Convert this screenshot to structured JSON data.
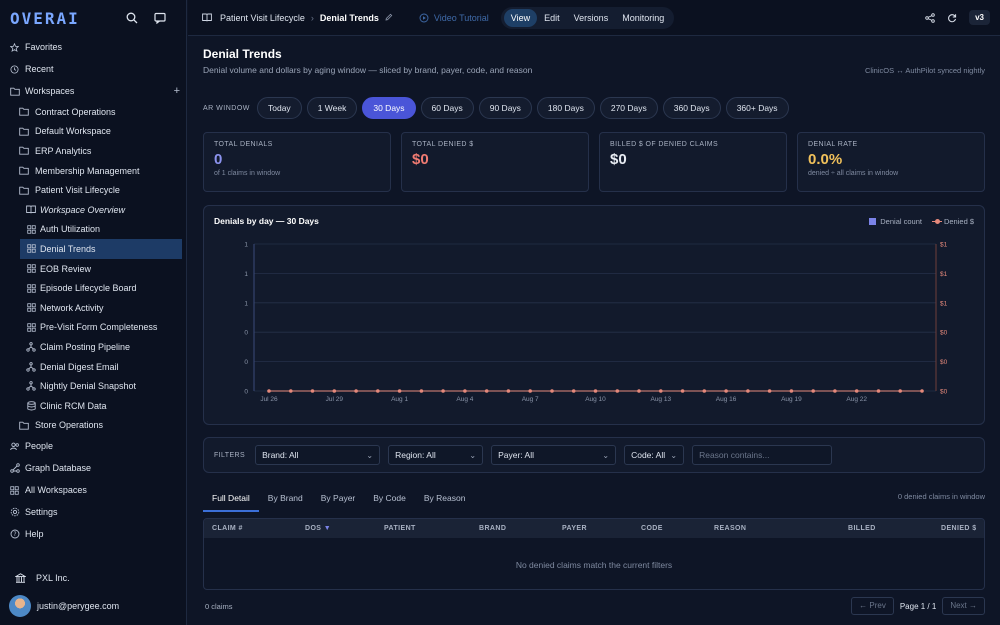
{
  "sidebar": {
    "logo": "OVERAI",
    "top_items": [
      {
        "label": "Favorites",
        "icon": "star-icon"
      },
      {
        "label": "Recent",
        "icon": "clock-icon"
      },
      {
        "label": "Workspaces",
        "icon": "folder-icon"
      }
    ],
    "workspaces": [
      {
        "label": "Contract Operations"
      },
      {
        "label": "Default Workspace"
      },
      {
        "label": "ERP Analytics"
      },
      {
        "label": "Membership Management"
      },
      {
        "label": "Patient Visit Lifecycle"
      }
    ],
    "children": [
      {
        "label": "Workspace Overview",
        "icon": "book-icon",
        "italic": true
      },
      {
        "label": "Auth Utilization",
        "icon": "grid-icon"
      },
      {
        "label": "Denial Trends",
        "icon": "grid-icon",
        "active": true
      },
      {
        "label": "EOB Review",
        "icon": "grid-icon"
      },
      {
        "label": "Episode Lifecycle Board",
        "icon": "grid-icon"
      },
      {
        "label": "Network Activity",
        "icon": "grid-icon"
      },
      {
        "label": "Pre-Visit Form Completeness",
        "icon": "grid-icon"
      },
      {
        "label": "Claim Posting Pipeline",
        "icon": "workflow-icon"
      },
      {
        "label": "Denial Digest Email",
        "icon": "workflow-icon"
      },
      {
        "label": "Nightly Denial Snapshot",
        "icon": "workflow-icon"
      },
      {
        "label": "Clinic RCM Data",
        "icon": "database-icon"
      }
    ],
    "store": {
      "label": "Store Operations"
    },
    "bottom_items": [
      {
        "label": "People",
        "icon": "people-icon"
      },
      {
        "label": "Graph Database",
        "icon": "graph-icon"
      },
      {
        "label": "All Workspaces",
        "icon": "grid-icon"
      },
      {
        "label": "Settings",
        "icon": "gear-icon"
      },
      {
        "label": "Help",
        "icon": "help-icon"
      }
    ],
    "org": "PXL Inc.",
    "user_email": "justin@perygee.com"
  },
  "topbar": {
    "parent": "Patient Visit Lifecycle",
    "current": "Denial Trends",
    "video": "Video Tutorial",
    "modes": [
      "View",
      "Edit",
      "Versions",
      "Monitoring"
    ],
    "active_mode": "View",
    "version": "v3"
  },
  "page": {
    "title": "Denial Trends",
    "subtitle": "Denial volume and dollars by aging window — sliced by brand, payer, code, and reason",
    "sync": "ClinicOS ↔ AuthPilot synced nightly"
  },
  "ar_window": {
    "label": "AR WINDOW",
    "options": [
      "Today",
      "1 Week",
      "30 Days",
      "60 Days",
      "90 Days",
      "180 Days",
      "270 Days",
      "360 Days",
      "360+ Days"
    ],
    "active": "30 Days"
  },
  "kpis": [
    {
      "label": "TOTAL DENIALS",
      "value": "0",
      "note": "of 1 claims in window",
      "color": "#8c93ee"
    },
    {
      "label": "TOTAL DENIED $",
      "value": "$0",
      "note": "",
      "color": "#f07b72"
    },
    {
      "label": "BILLED $ OF DENIED CLAIMS",
      "value": "$0",
      "note": "",
      "color": "#e8ecf3"
    },
    {
      "label": "DENIAL RATE",
      "value": "0.0%",
      "note": "denied ÷ all claims in window",
      "color": "#f1c15b"
    }
  ],
  "chart_data": {
    "type": "line",
    "title": "Denials by day — 30 Days",
    "legend": [
      {
        "name": "Denial count",
        "color": "#7b83e8"
      },
      {
        "name": "Denied $",
        "color": "#e5897b"
      }
    ],
    "x_ticks": [
      "Jul 26",
      "Jul 29",
      "Aug 1",
      "Aug 4",
      "Aug 7",
      "Aug 10",
      "Aug 13",
      "Aug 16",
      "Aug 19",
      "Aug 22"
    ],
    "y_left_ticks": [
      "1",
      "1",
      "1",
      "0",
      "0",
      "0"
    ],
    "y_right_ticks": [
      "$1",
      "$1",
      "$1",
      "$0",
      "$0",
      "$0"
    ],
    "series": [
      {
        "name": "Denial count",
        "values": [
          0,
          0,
          0,
          0,
          0,
          0,
          0,
          0,
          0,
          0,
          0,
          0,
          0,
          0,
          0,
          0,
          0,
          0,
          0,
          0,
          0,
          0,
          0,
          0,
          0,
          0,
          0,
          0,
          0,
          0,
          0
        ]
      },
      {
        "name": "Denied $",
        "values": [
          0,
          0,
          0,
          0,
          0,
          0,
          0,
          0,
          0,
          0,
          0,
          0,
          0,
          0,
          0,
          0,
          0,
          0,
          0,
          0,
          0,
          0,
          0,
          0,
          0,
          0,
          0,
          0,
          0,
          0,
          0
        ]
      }
    ],
    "grid": true,
    "legend_position": "top-right"
  },
  "filters": {
    "label": "FILTERS",
    "brand": "Brand: All",
    "region": "Region: All",
    "payer": "Payer: All",
    "code": "Code: All",
    "reason_placeholder": "Reason contains..."
  },
  "tabs": [
    "Full Detail",
    "By Brand",
    "By Payer",
    "By Code",
    "By Reason"
  ],
  "active_tab": "Full Detail",
  "denied_count_text": "0 denied claims in window",
  "table": {
    "columns": [
      "CLAIM #",
      "DOS",
      "PATIENT",
      "BRAND",
      "PAYER",
      "CODE",
      "REASON",
      "BILLED",
      "DENIED $"
    ],
    "sort_arrow": "▼",
    "empty": "No denied claims match the current filters"
  },
  "footer": {
    "claims": "0 claims",
    "prev": "← Prev",
    "page": "Page 1 / 1",
    "next": "Next →"
  }
}
